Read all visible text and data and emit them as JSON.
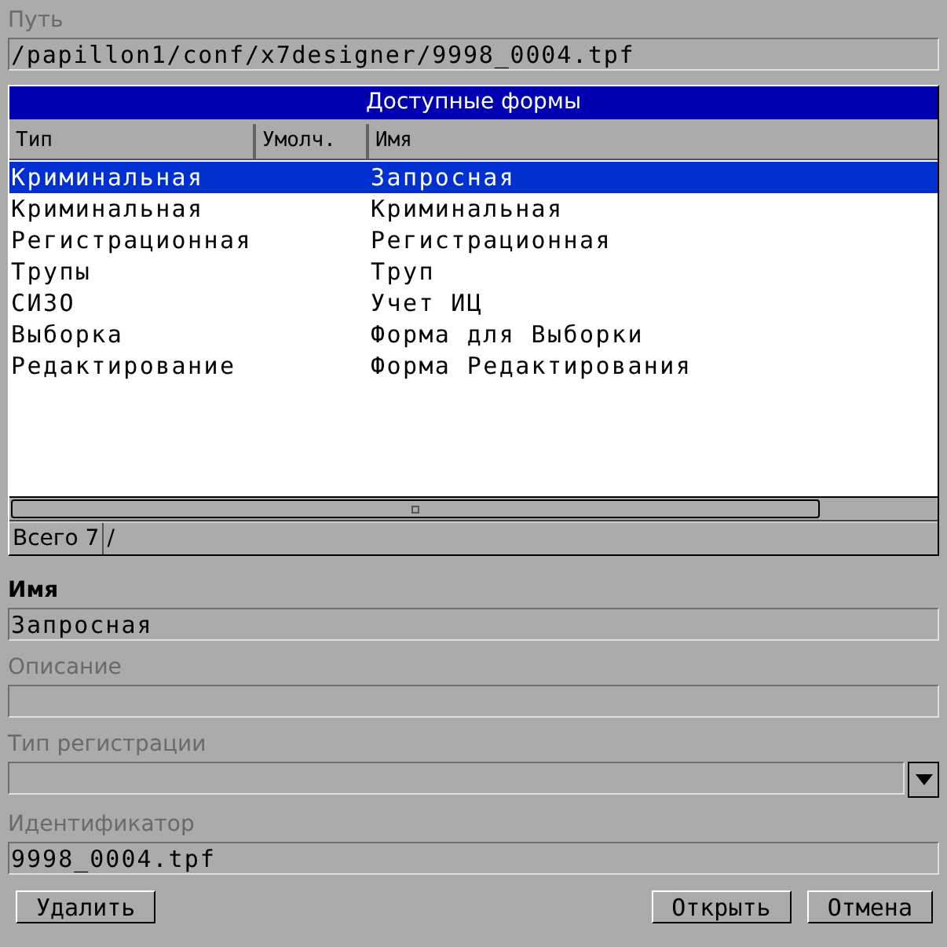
{
  "path": {
    "label": "Путь",
    "value": "/papillon1/conf/x7designer/9998_0004.tpf",
    "disabled": true
  },
  "forms_table": {
    "title": "Доступные формы",
    "columns": [
      "Тип",
      "Умолч.",
      "Имя"
    ],
    "rows": [
      {
        "type": "Криминальная",
        "name": "Запросная",
        "selected": true
      },
      {
        "type": "Криминальная",
        "name": "Криминальная",
        "selected": false
      },
      {
        "type": "Регистрационная",
        "name": "Регистрационная",
        "selected": false
      },
      {
        "type": "Трупы",
        "name": "Труп",
        "selected": false
      },
      {
        "type": "СИЗО",
        "name": "Учет ИЦ",
        "selected": false
      },
      {
        "type": "Выборка",
        "name": "Форма для Выборки",
        "selected": false
      },
      {
        "type": "Редактирование",
        "name": "Форма Редактирования",
        "selected": false
      }
    ],
    "status": [
      "Всего 7",
      "/"
    ]
  },
  "fields": [
    {
      "kind": "text",
      "label": "Имя",
      "value": "Запросная",
      "disabled": false
    },
    {
      "kind": "text",
      "label": "Описание",
      "disabled": true
    },
    {
      "kind": "combo",
      "label": "Тип регистрации",
      "disabled": true
    },
    {
      "kind": "text",
      "label": "Идентификатор",
      "value": "9998_0004.tpf",
      "disabled": true
    }
  ],
  "buttons_left": [
    "Удалить"
  ],
  "buttons_right": [
    "Открыть",
    "Отмена"
  ]
}
